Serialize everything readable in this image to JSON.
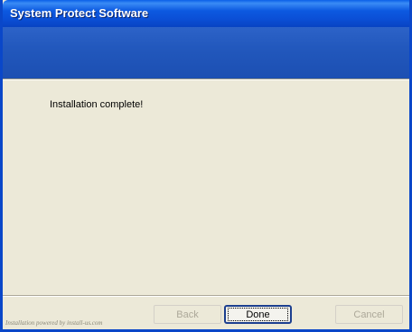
{
  "window": {
    "title": "System Protect Software"
  },
  "content": {
    "message": "Installation complete!"
  },
  "footer": {
    "powered_by": "Installation powered by install-us.com"
  },
  "buttons": {
    "back": {
      "label": "Back",
      "enabled": false
    },
    "done": {
      "label": "Done",
      "enabled": true,
      "default": true
    },
    "cancel": {
      "label": "Cancel",
      "enabled": false
    }
  },
  "colors": {
    "titlebar": "#0b4fd6",
    "header_band": "#2258bd",
    "dialog_background": "#ece9d8",
    "disabled_text": "#aca899"
  }
}
